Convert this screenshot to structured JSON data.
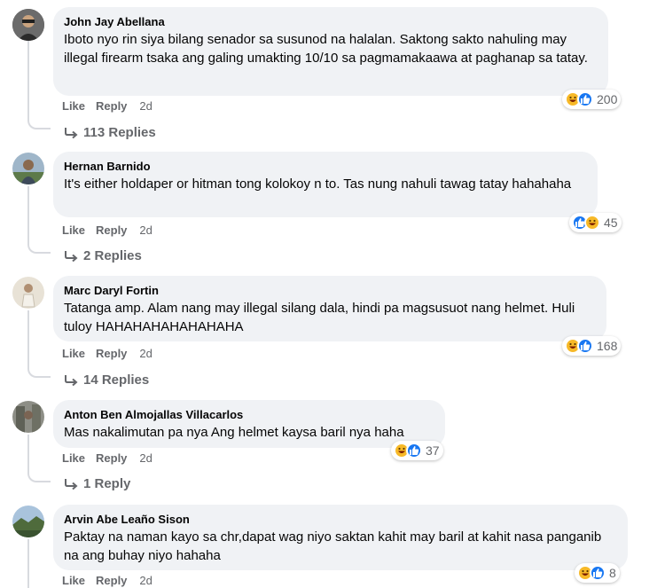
{
  "actions": {
    "like": "Like",
    "reply": "Reply"
  },
  "colors": {
    "bubble_bg": "#f0f2f5",
    "meta_text": "#65676b",
    "like_blue": "#1877f2",
    "haha_yellow": "#f7b928"
  },
  "comments": [
    {
      "author": "John Jay Abellana",
      "text": "Iboto nyo rin siya bilang senador sa susunod na halalan. Saktong sakto nahuling may illegal firearm tsaka ang galing umakting 10/10 sa pagmamakaawa at paghanap sa tatay.",
      "time": "2d",
      "reaction_icons": [
        "haha",
        "like"
      ],
      "reaction_count": "200",
      "replies": "113 Replies"
    },
    {
      "author": "Hernan Barnido",
      "text": "It's either holdaper or hitman tong kolokoy n to. Tas nung nahuli tawag tatay hahahaha",
      "time": "2d",
      "reaction_icons": [
        "like",
        "haha"
      ],
      "reaction_count": "45",
      "replies": "2 Replies"
    },
    {
      "author": "Marc Daryl Fortin",
      "text": "Tatanga amp. Alam nang may illegal silang dala, hindi pa magsusuot nang helmet. Huli tuloy HAHAHAHAHAHAHAHA",
      "time": "2d",
      "reaction_icons": [
        "haha",
        "like"
      ],
      "reaction_count": "168",
      "replies": "14 Replies"
    },
    {
      "author": "Anton Ben Almojallas Villacarlos",
      "text": "Mas nakalimutan pa nya Ang helmet kaysa baril nya haha",
      "time": "2d",
      "reaction_icons": [
        "haha",
        "like"
      ],
      "reaction_count": "37",
      "replies": "1 Reply"
    },
    {
      "author": "Arvin Abe Leaño Sison",
      "text": "Paktay na naman kayo sa chr,dapat wag niyo saktan kahit may baril at kahit nasa panganib na ang buhay niyo hahaha",
      "time": "2d",
      "reaction_icons": [
        "haha",
        "like"
      ],
      "reaction_count": "8"
    }
  ]
}
